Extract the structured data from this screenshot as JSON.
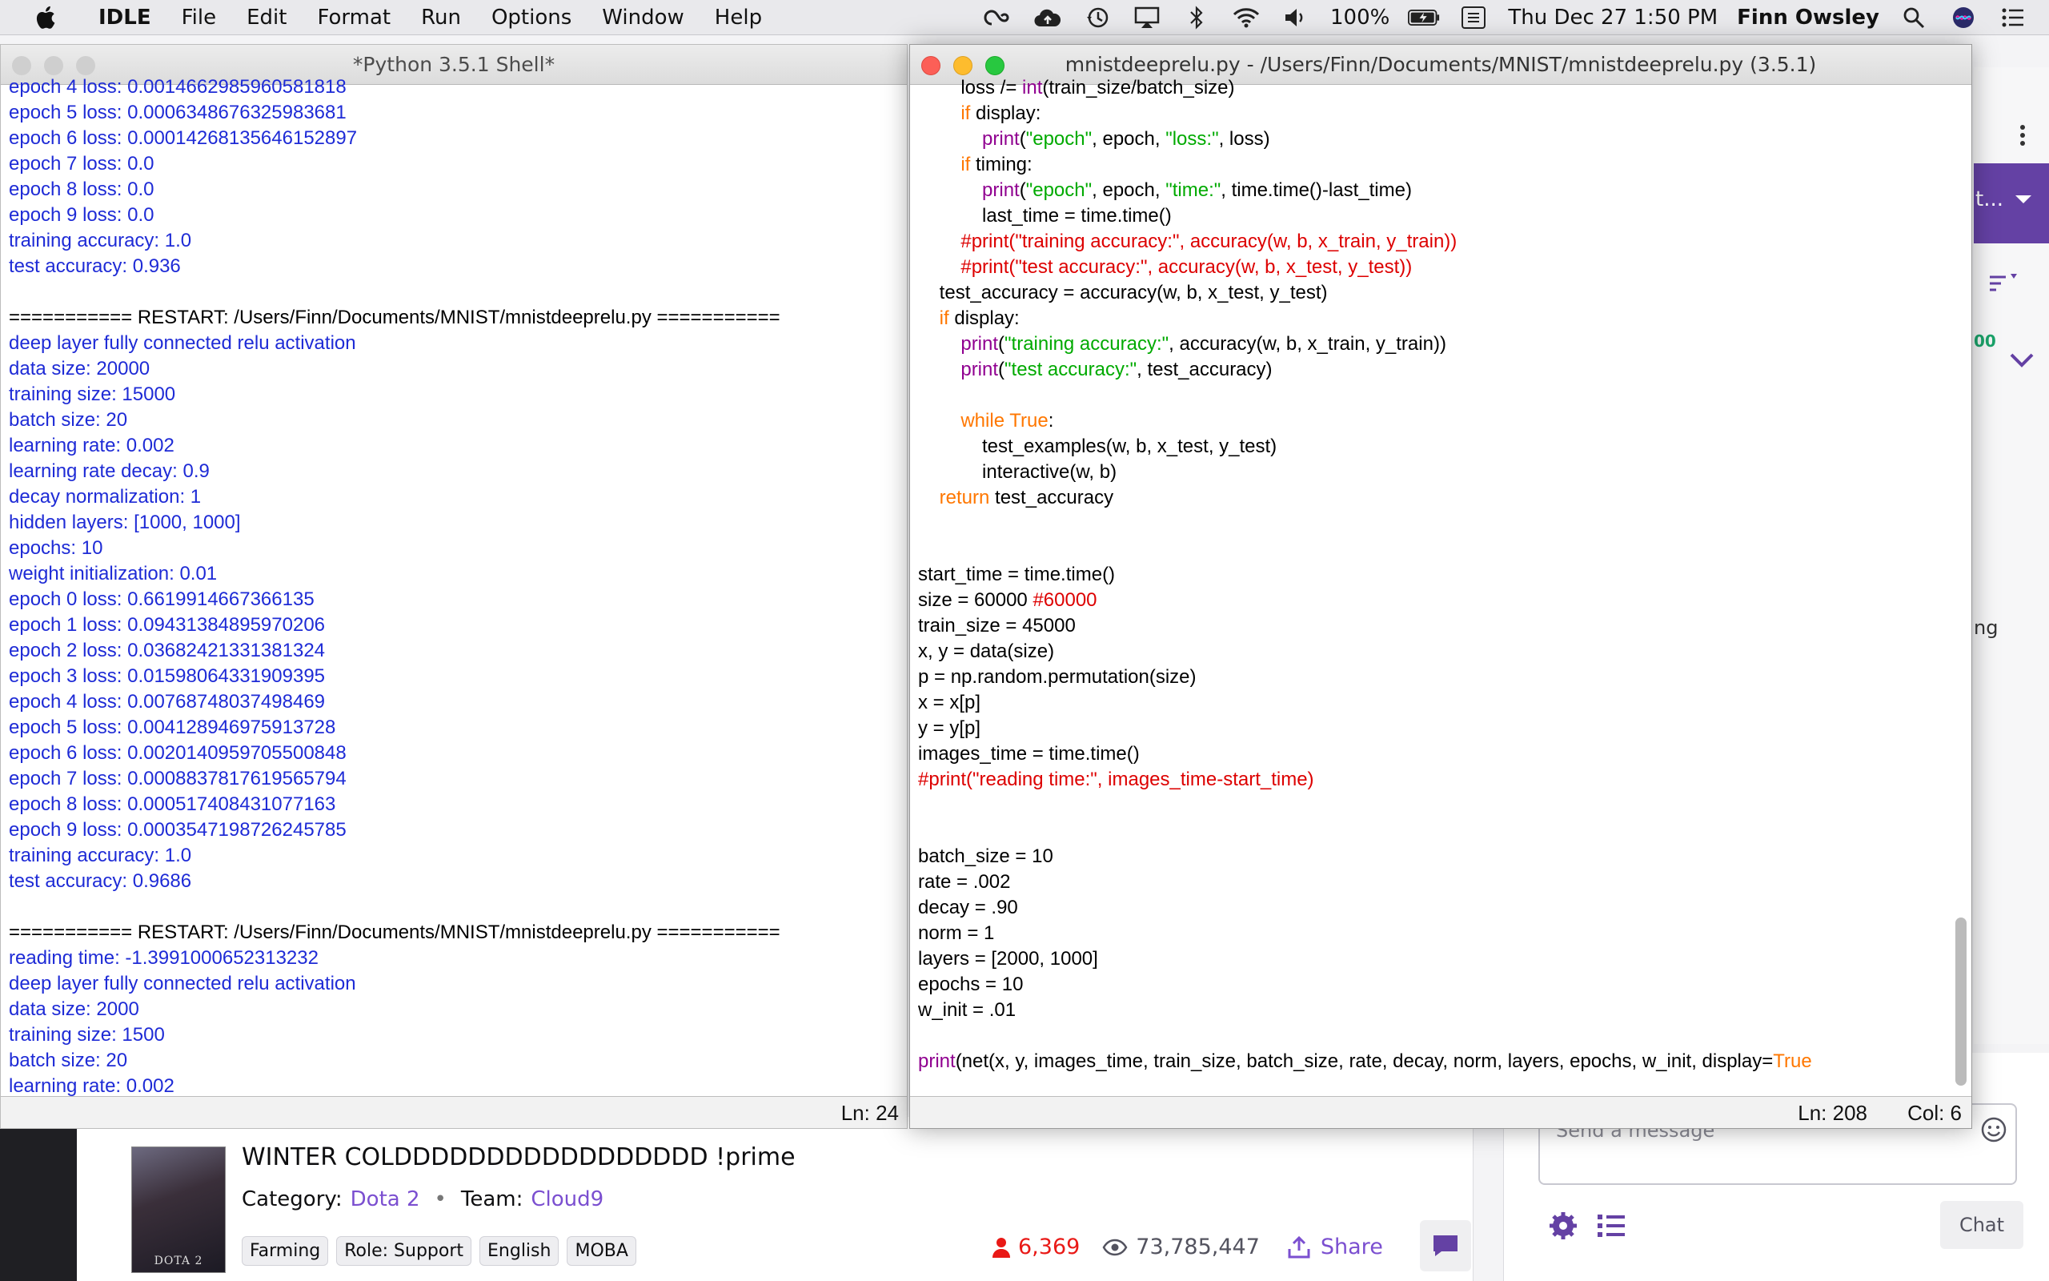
{
  "menubar": {
    "app": "IDLE",
    "menus": [
      "File",
      "Edit",
      "Format",
      "Run",
      "Options",
      "Window",
      "Help"
    ],
    "battery": "100%",
    "datetime": "Thu Dec 27  1:50 PM",
    "user": "Finn Owsley",
    "status_icons": [
      "creative-cloud-icon",
      "upload-cloud-icon",
      "time-machine-icon",
      "airplay-icon",
      "bluetooth-icon",
      "wifi-icon",
      "volume-icon",
      "battery-icon",
      "keyboard-icon",
      "spotlight-icon",
      "siri-icon",
      "notification-center-icon"
    ]
  },
  "shell": {
    "title": "*Python 3.5.1 Shell*",
    "status": "Ln: 24",
    "lines": [
      {
        "c": "blue",
        "t": "epoch 4 loss: 0.0014662985960581818"
      },
      {
        "c": "blue",
        "t": "epoch 5 loss: 0.0006348676325983681"
      },
      {
        "c": "blue",
        "t": "epoch 6 loss: 0.00014268135646152897"
      },
      {
        "c": "blue",
        "t": "epoch 7 loss: 0.0"
      },
      {
        "c": "blue",
        "t": "epoch 8 loss: 0.0"
      },
      {
        "c": "blue",
        "t": "epoch 9 loss: 0.0"
      },
      {
        "c": "blue",
        "t": "training accuracy: 1.0"
      },
      {
        "c": "blue",
        "t": "test accuracy: 0.936"
      },
      {
        "c": "blk",
        "t": ""
      },
      {
        "c": "blk",
        "t": "=========== RESTART: /Users/Finn/Documents/MNIST/mnistdeeprelu.py ==========="
      },
      {
        "c": "blue",
        "t": "deep layer fully connected relu activation"
      },
      {
        "c": "blue",
        "t": "data size: 20000"
      },
      {
        "c": "blue",
        "t": "training size: 15000"
      },
      {
        "c": "blue",
        "t": "batch size: 20"
      },
      {
        "c": "blue",
        "t": "learning rate: 0.002"
      },
      {
        "c": "blue",
        "t": "learning rate decay: 0.9"
      },
      {
        "c": "blue",
        "t": "decay normalization: 1"
      },
      {
        "c": "blue",
        "t": "hidden layers: [1000, 1000]"
      },
      {
        "c": "blue",
        "t": "epochs: 10"
      },
      {
        "c": "blue",
        "t": "weight initialization: 0.01"
      },
      {
        "c": "blue",
        "t": "epoch 0 loss: 0.6619914667366135"
      },
      {
        "c": "blue",
        "t": "epoch 1 loss: 0.09431384895970206"
      },
      {
        "c": "blue",
        "t": "epoch 2 loss: 0.03682421331381324"
      },
      {
        "c": "blue",
        "t": "epoch 3 loss: 0.01598064331909395"
      },
      {
        "c": "blue",
        "t": "epoch 4 loss: 0.007687480374984 69"
      },
      {
        "c": "blue",
        "t": "epoch 5 loss: 0.004128946975913728"
      },
      {
        "c": "blue",
        "t": "epoch 6 loss: 0.0020140959705500848"
      },
      {
        "c": "blue",
        "t": "epoch 7 loss: 0.0008837817619565794"
      },
      {
        "c": "blue",
        "t": "epoch 8 loss: 0.000517408431077163"
      },
      {
        "c": "blue",
        "t": "epoch 9 loss: 0.0003547198726245785"
      },
      {
        "c": "blue",
        "t": "training accuracy: 1.0"
      },
      {
        "c": "blue",
        "t": "test accuracy: 0.9686"
      },
      {
        "c": "blk",
        "t": ""
      },
      {
        "c": "blk",
        "t": "=========== RESTART: /Users/Finn/Documents/MNIST/mnistdeeprelu.py ==========="
      },
      {
        "c": "blue",
        "t": "reading time: -1.3991000652313232"
      },
      {
        "c": "blue",
        "t": "deep layer fully connected relu activation"
      },
      {
        "c": "blue",
        "t": "data size: 2000"
      },
      {
        "c": "blue",
        "t": "training size: 1500"
      },
      {
        "c": "blue",
        "t": "batch size: 20"
      },
      {
        "c": "blue",
        "t": "learning rate: 0.002"
      }
    ]
  },
  "editor": {
    "title": "mnistdeeprelu.py - /Users/Finn/Documents/MNIST/mnistdeeprelu.py (3.5.1)",
    "status_ln": "Ln: 208",
    "status_col": "Col: 6",
    "lines": [
      [
        [
          "n",
          "        loss /= "
        ],
        [
          "bi",
          "int"
        ],
        [
          "n",
          "(train_size/batch_size)"
        ]
      ],
      [
        [
          "n",
          "        "
        ],
        [
          "kw",
          "if"
        ],
        [
          "n",
          " display:"
        ]
      ],
      [
        [
          "n",
          "            "
        ],
        [
          "bi",
          "print"
        ],
        [
          "n",
          "("
        ],
        [
          "str",
          "\"epoch\""
        ],
        [
          "n",
          ", epoch, "
        ],
        [
          "str",
          "\"loss:\""
        ],
        [
          "n",
          ", loss)"
        ]
      ],
      [
        [
          "n",
          "        "
        ],
        [
          "kw",
          "if"
        ],
        [
          "n",
          " timing:"
        ]
      ],
      [
        [
          "n",
          "            "
        ],
        [
          "bi",
          "print"
        ],
        [
          "n",
          "("
        ],
        [
          "str",
          "\"epoch\""
        ],
        [
          "n",
          ", epoch, "
        ],
        [
          "str",
          "\"time:\""
        ],
        [
          "n",
          ", time.time()-last_time)"
        ]
      ],
      [
        [
          "n",
          "            last_time = time.time()"
        ]
      ],
      [
        [
          "n",
          "        "
        ],
        [
          "cm",
          "#print(\"training accuracy:\", accuracy(w, b, x_train, y_train))"
        ]
      ],
      [
        [
          "n",
          "        "
        ],
        [
          "cm",
          "#print(\"test accuracy:\", accuracy(w, b, x_test, y_test))"
        ]
      ],
      [
        [
          "n",
          "    test_accuracy = accuracy(w, b, x_test, y_test)"
        ]
      ],
      [
        [
          "n",
          "    "
        ],
        [
          "kw",
          "if"
        ],
        [
          "n",
          " display:"
        ]
      ],
      [
        [
          "n",
          "        "
        ],
        [
          "bi",
          "print"
        ],
        [
          "n",
          "("
        ],
        [
          "str",
          "\"training accuracy:\""
        ],
        [
          "n",
          ", accuracy(w, b, x_train, y_train))"
        ]
      ],
      [
        [
          "n",
          "        "
        ],
        [
          "bi",
          "print"
        ],
        [
          "n",
          "("
        ],
        [
          "str",
          "\"test accuracy:\""
        ],
        [
          "n",
          ", test_accuracy)"
        ]
      ],
      [
        [
          "n",
          ""
        ]
      ],
      [
        [
          "n",
          "        "
        ],
        [
          "kw",
          "while"
        ],
        [
          "n",
          " "
        ],
        [
          "kw",
          "True"
        ],
        [
          "n",
          ":"
        ]
      ],
      [
        [
          "n",
          "            test_examples(w, b, x_test, y_test)"
        ]
      ],
      [
        [
          "n",
          "            interactive(w, b)"
        ]
      ],
      [
        [
          "n",
          "    "
        ],
        [
          "kw",
          "return"
        ],
        [
          "n",
          " test_accuracy"
        ]
      ],
      [
        [
          "n",
          ""
        ]
      ],
      [
        [
          "n",
          ""
        ]
      ],
      [
        [
          "n",
          "start_time = time.time()"
        ]
      ],
      [
        [
          "n",
          "size = 60000 "
        ],
        [
          "cm",
          "#60000"
        ]
      ],
      [
        [
          "n",
          "train_size = 45000"
        ]
      ],
      [
        [
          "n",
          "x, y = data(size)"
        ]
      ],
      [
        [
          "n",
          "p = np.random.permutation(size)"
        ]
      ],
      [
        [
          "n",
          "x = x[p]"
        ]
      ],
      [
        [
          "n",
          "y = y[p]"
        ]
      ],
      [
        [
          "n",
          "images_time = time.time()"
        ]
      ],
      [
        [
          "cm",
          "#print(\"reading time:\", images_time-start_time)"
        ]
      ],
      [
        [
          "n",
          ""
        ]
      ],
      [
        [
          "n",
          ""
        ]
      ],
      [
        [
          "n",
          "batch_size = 10"
        ]
      ],
      [
        [
          "n",
          "rate = .002"
        ]
      ],
      [
        [
          "n",
          "decay = .90"
        ]
      ],
      [
        [
          "n",
          "norm = 1"
        ]
      ],
      [
        [
          "n",
          "layers = [2000, 1000]"
        ]
      ],
      [
        [
          "n",
          "epochs = 10"
        ]
      ],
      [
        [
          "n",
          "w_init = .01"
        ]
      ],
      [
        [
          "n",
          ""
        ]
      ],
      [
        [
          "bi",
          "print"
        ],
        [
          "n",
          "(net(x, y, images_time, train_size, batch_size, rate, decay, norm, layers, epochs, w_init, display="
        ],
        [
          "kw",
          "True"
        ]
      ]
    ]
  },
  "stream": {
    "title": "WINTER COLDDDDDDDDDDDDDDDDD !prime",
    "category_label": "Category:",
    "category": "Dota 2",
    "team_label": "Team:",
    "team": "Cloud9",
    "separator": "•",
    "cover_text": "DOTA 2",
    "tags": [
      "Farming",
      "Role: Support",
      "English",
      "MOBA"
    ],
    "viewers": "6,369",
    "views": "73,785,447",
    "share": "Share"
  },
  "chat": {
    "placeholder": "Send a message",
    "button": "Chat"
  },
  "sidepanel": {
    "fragment_top": "t...",
    "fragment_mid": "00",
    "fragment_ng": "ng"
  },
  "colors": {
    "idle_output_blue": "#1e2bd6",
    "keyword": "#ff7700",
    "builtin": "#900090",
    "string": "#00aa00",
    "comment": "#dd0000",
    "twitch_purple": "#6441a4",
    "live_red": "#e91916"
  }
}
